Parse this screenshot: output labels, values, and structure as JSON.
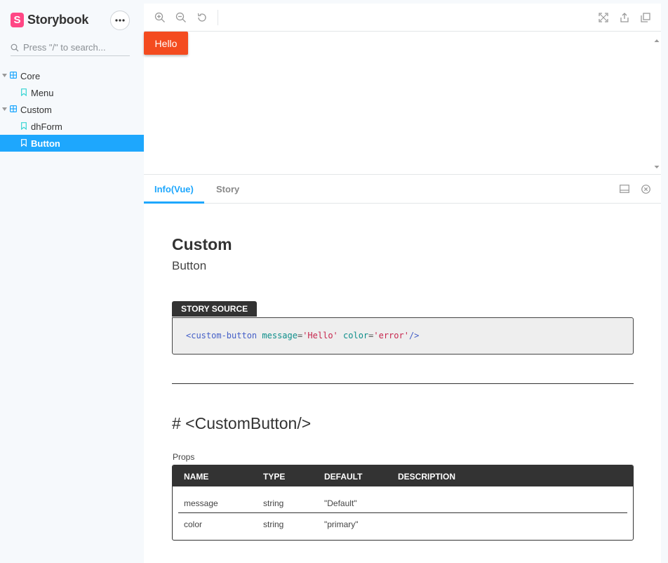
{
  "brand": {
    "name": "Storybook",
    "logo_letter": "S"
  },
  "search": {
    "placeholder": "Press \"/\" to search..."
  },
  "tree": {
    "items": [
      {
        "label": "Core",
        "kind": "component"
      },
      {
        "label": "Menu",
        "kind": "story"
      },
      {
        "label": "Custom",
        "kind": "component"
      },
      {
        "label": "dhForm",
        "kind": "story"
      },
      {
        "label": "Button",
        "kind": "story",
        "selected": true
      }
    ]
  },
  "preview": {
    "button_label": "Hello",
    "button_color": "#f44b1f"
  },
  "addons": {
    "tabs": [
      {
        "label": "Info(Vue)",
        "active": true
      },
      {
        "label": "Story"
      }
    ]
  },
  "doc": {
    "title": "Custom",
    "subtitle": "Button",
    "source_label": "STORY SOURCE",
    "source": {
      "open": "<custom-button",
      "attr1": "message",
      "val1": "'Hello'",
      "attr2": "color",
      "val2": "'error'",
      "close": "/>"
    },
    "component_heading": "# <CustomButton/>",
    "props_label": "Props",
    "props_columns": [
      "NAME",
      "TYPE",
      "DEFAULT",
      "DESCRIPTION"
    ],
    "props_rows": [
      {
        "name": "message",
        "type": "string",
        "default": "\"Default\"",
        "description": ""
      },
      {
        "name": "color",
        "type": "string",
        "default": "\"primary\"",
        "description": ""
      }
    ]
  },
  "colors": {
    "accent": "#1ea7fd",
    "brand": "#ff4785",
    "sidebar_bg": "#f6f9fc"
  }
}
